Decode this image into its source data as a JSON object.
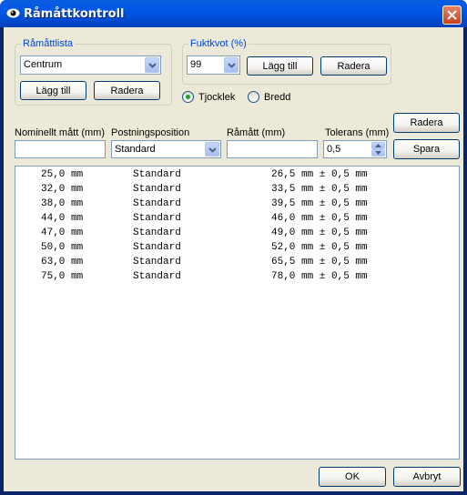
{
  "window": {
    "title": "Råmåttkontroll"
  },
  "ramattlista": {
    "legend": "Råmåttlista",
    "selected": "Centrum",
    "add_label": "Lägg till",
    "delete_label": "Radera"
  },
  "fuktkvot": {
    "legend": "Fuktkvot (%)",
    "selected": "99",
    "add_label": "Lägg till",
    "delete_label": "Radera"
  },
  "dimension": {
    "options": [
      {
        "label": "Tjocklek",
        "checked": true
      },
      {
        "label": "Bredd",
        "checked": false
      }
    ]
  },
  "form": {
    "nominal_label": "Nominellt mått (mm)",
    "nominal_value": "",
    "position_label": "Postningsposition",
    "position_value": "Standard",
    "ramatt_label": "Råmått (mm)",
    "ramatt_value": "",
    "tolerance_label": "Tolerans (mm)",
    "tolerance_value": "0,5",
    "delete_label": "Radera",
    "save_label": "Spara"
  },
  "rows": [
    {
      "nominal": "25,0 mm",
      "position": "Standard",
      "raw": "26,5 mm ± 0,5 mm"
    },
    {
      "nominal": "32,0 mm",
      "position": "Standard",
      "raw": "33,5 mm ± 0,5 mm"
    },
    {
      "nominal": "38,0 mm",
      "position": "Standard",
      "raw": "39,5 mm ± 0,5 mm"
    },
    {
      "nominal": "44,0 mm",
      "position": "Standard",
      "raw": "46,0 mm ± 0,5 mm"
    },
    {
      "nominal": "47,0 mm",
      "position": "Standard",
      "raw": "49,0 mm ± 0,5 mm"
    },
    {
      "nominal": "50,0 mm",
      "position": "Standard",
      "raw": "52,0 mm ± 0,5 mm"
    },
    {
      "nominal": "63,0 mm",
      "position": "Standard",
      "raw": "65,5 mm ± 0,5 mm"
    },
    {
      "nominal": "75,0 mm",
      "position": "Standard",
      "raw": "78,0 mm ± 0,5 mm"
    }
  ],
  "footer": {
    "ok_label": "OK",
    "cancel_label": "Avbryt"
  }
}
